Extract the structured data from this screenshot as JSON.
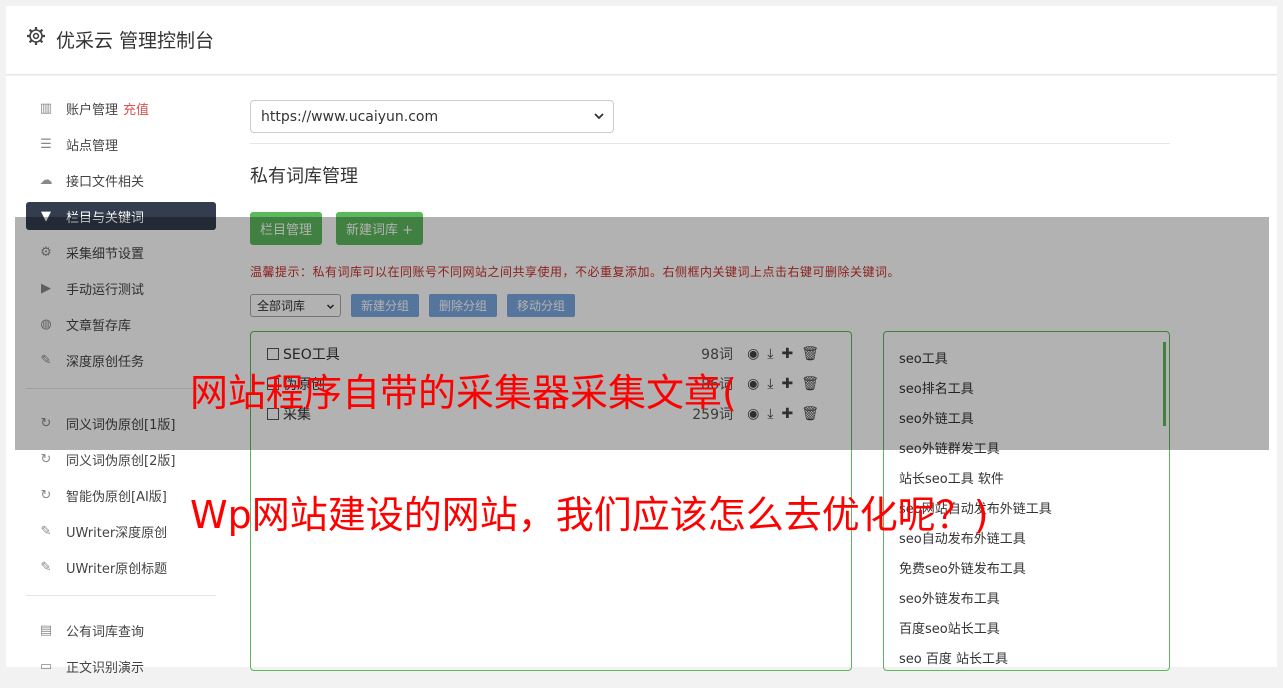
{
  "header": {
    "title": "优采云 管理控制台",
    "icon": "gear-icon"
  },
  "sidebar": {
    "items": [
      {
        "label": "账户管理",
        "badge": "充值",
        "icon": "bar-chart-icon"
      },
      {
        "label": "站点管理",
        "icon": "server-icon"
      },
      {
        "label": "接口文件相关",
        "icon": "cloud-upload-icon"
      },
      {
        "label": "栏目与关键词",
        "icon": "filter-icon",
        "active": true
      },
      {
        "label": "采集细节设置",
        "icon": "cogs-icon"
      },
      {
        "label": "手动运行测试",
        "icon": "play-circle-icon"
      },
      {
        "label": "文章暂存库",
        "icon": "database-icon"
      },
      {
        "label": "深度原创任务",
        "icon": "edit-icon"
      }
    ],
    "items2": [
      {
        "label": "同义词伪原创[1版]",
        "icon": "refresh-icon"
      },
      {
        "label": "同义词伪原创[2版]",
        "icon": "refresh-icon"
      },
      {
        "label": "智能伪原创[AI版]",
        "icon": "refresh-icon"
      },
      {
        "label": "UWriter深度原创",
        "icon": "edit-icon"
      },
      {
        "label": "UWriter原创标题",
        "icon": "edit-icon"
      }
    ],
    "items3": [
      {
        "label": "公有词库查询",
        "icon": "book-icon"
      },
      {
        "label": "正文识别演示",
        "icon": "monitor-icon"
      }
    ]
  },
  "main": {
    "site_select_value": "https://www.ucaiyun.com",
    "section_title": "私有词库管理",
    "buttons": {
      "column_manage": "栏目管理",
      "new_library": "新建词库 +"
    },
    "tip": "温馨提示：私有词库可以在同账号不同网站之间共享使用，不必重复添加。右侧框内关键词上点击右键可删除关键词。",
    "group_select": "全部词库",
    "group_buttons": {
      "new_group": "新建分组",
      "delete_group": "删除分组",
      "move_group": "移动分组"
    },
    "libraries": [
      {
        "name": "SEO工具",
        "count": "98词"
      },
      {
        "name": "伪原创",
        "count": "86词"
      },
      {
        "name": "采集",
        "count": "259词"
      }
    ],
    "keywords": [
      "seo工具",
      "seo排名工具",
      "seo外链工具",
      "seo外链群发工具",
      "站长seo工具 软件",
      "seo网站自动发布外链工具",
      "seo自动发布外链工具",
      "免费seo外链发布工具",
      "seo外链发布工具",
      "百度seo站长工具",
      "seo 百度 站长工具"
    ]
  },
  "overlay": {
    "line1": "网站程序自带的采集器采集文章(",
    "line2": "Wp网站建设的网站，我们应该怎么去优化呢？)"
  },
  "colors": {
    "accent_green": "#5cb85c",
    "accent_blue": "#7aa8e0",
    "active_nav": "#333d4e",
    "overlay_text": "#ff0000"
  }
}
